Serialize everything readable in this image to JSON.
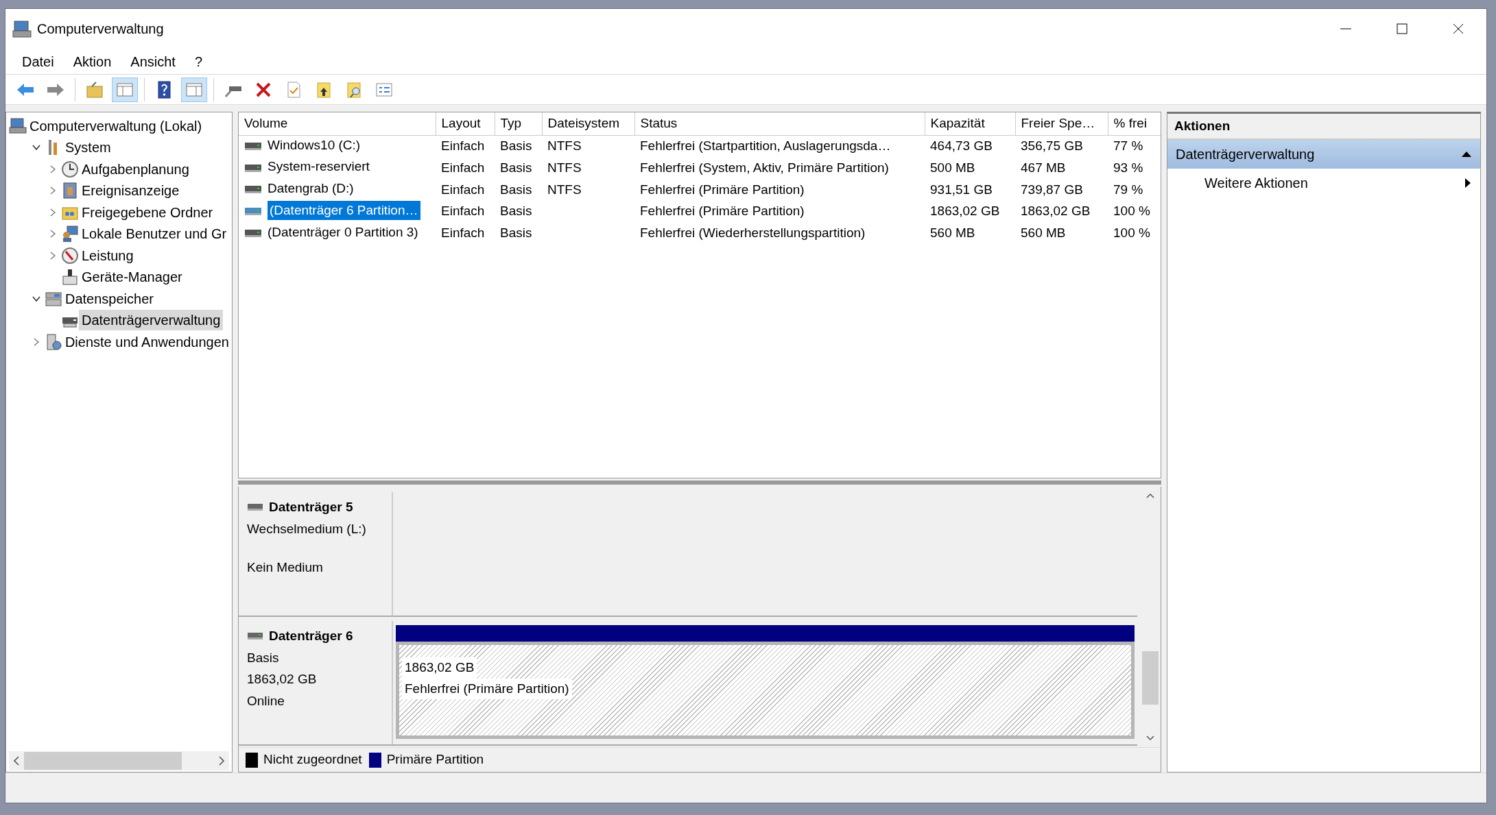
{
  "window": {
    "title": "Computerverwaltung"
  },
  "menu": [
    {
      "label": "Datei"
    },
    {
      "label": "Aktion"
    },
    {
      "label": "Ansicht"
    },
    {
      "label": "?"
    }
  ],
  "toolbar": [
    {
      "pressed": false
    },
    {
      "pressed": false
    },
    {
      "pressed": false
    },
    {
      "pressed": true
    },
    {
      "pressed": false
    },
    {
      "pressed": true
    },
    {
      "pressed": false
    },
    {
      "pressed": false
    },
    {
      "pressed": false
    },
    {
      "pressed": false
    },
    {
      "pressed": false
    },
    {
      "pressed": false
    }
  ],
  "tree": [
    {
      "label": "Computerverwaltung (Lokal)",
      "selected": false,
      "children": [
        {
          "label": "System",
          "expanded": true,
          "selected": false,
          "children": [
            {
              "label": "Aufgabenplanung",
              "expanded": false,
              "selected": false
            },
            {
              "label": "Ereignisanzeige",
              "expanded": false,
              "selected": false
            },
            {
              "label": "Freigegebene Ordner",
              "expanded": false,
              "selected": false
            },
            {
              "label": "Lokale Benutzer und Gr",
              "expanded": false,
              "selected": false
            },
            {
              "label": "Leistung",
              "expanded": false,
              "selected": false
            },
            {
              "label": "Geräte-Manager",
              "selected": false
            }
          ]
        },
        {
          "label": "Datenspeicher",
          "expanded": true,
          "selected": false,
          "children": [
            {
              "label": "Datenträgerverwaltung",
              "selected": true
            }
          ]
        },
        {
          "label": "Dienste und Anwendungen",
          "expanded": false,
          "selected": false
        }
      ]
    }
  ],
  "table": {
    "columns": [
      "Volume",
      "Layout",
      "Typ",
      "Dateisystem",
      "Status",
      "Kapazität",
      "Freier Spe…",
      "% frei"
    ],
    "rows": [
      {
        "cells": [
          "Windows10 (C:)",
          "Einfach",
          "Basis",
          "NTFS",
          "Fehlerfrei (Startpartition, Auslagerungsda…",
          "464,73 GB",
          "356,75 GB",
          "77 %"
        ],
        "selected": false
      },
      {
        "cells": [
          "System-reserviert",
          "Einfach",
          "Basis",
          "NTFS",
          "Fehlerfrei (System, Aktiv, Primäre Partition)",
          "500 MB",
          "467 MB",
          "93 %"
        ],
        "selected": false
      },
      {
        "cells": [
          "Datengrab (D:)",
          "Einfach",
          "Basis",
          "NTFS",
          "Fehlerfrei (Primäre Partition)",
          "931,51 GB",
          "739,87 GB",
          "79 %"
        ],
        "selected": false
      },
      {
        "cells": [
          "(Datenträger 6 Partition…",
          "Einfach",
          "Basis",
          "",
          "Fehlerfrei (Primäre Partition)",
          "1863,02 GB",
          "1863,02 GB",
          "100 %"
        ],
        "selected": true
      },
      {
        "cells": [
          "(Datenträger 0 Partition 3)",
          "Einfach",
          "Basis",
          "",
          "Fehlerfrei (Wiederherstellungspartition)",
          "560 MB",
          "560 MB",
          "100 %"
        ],
        "selected": false
      }
    ]
  },
  "disks": [
    {
      "name": "Datenträger 5",
      "info": [
        "Wechselmedium (L:)"
      ],
      "status": "Kein Medium",
      "online": false
    },
    {
      "name": "Datenträger 6",
      "info": [
        "Basis",
        "1863,02 GB",
        "Online"
      ],
      "online": true,
      "partitions": [
        {
          "size": "1863,02 GB",
          "status": "Fehlerfrei (Primäre Partition)",
          "color": "#000080",
          "selected": true
        }
      ]
    }
  ],
  "legend": [
    {
      "label": "Nicht zugeordnet",
      "color": "#000000"
    },
    {
      "label": "Primäre Partition",
      "color": "#000080"
    }
  ],
  "actions": {
    "title": "Aktionen",
    "groups": [
      {
        "title": "Datenträgerverwaltung",
        "expanded": true,
        "items": [
          {
            "label": "Weitere Aktionen"
          }
        ]
      }
    ]
  }
}
